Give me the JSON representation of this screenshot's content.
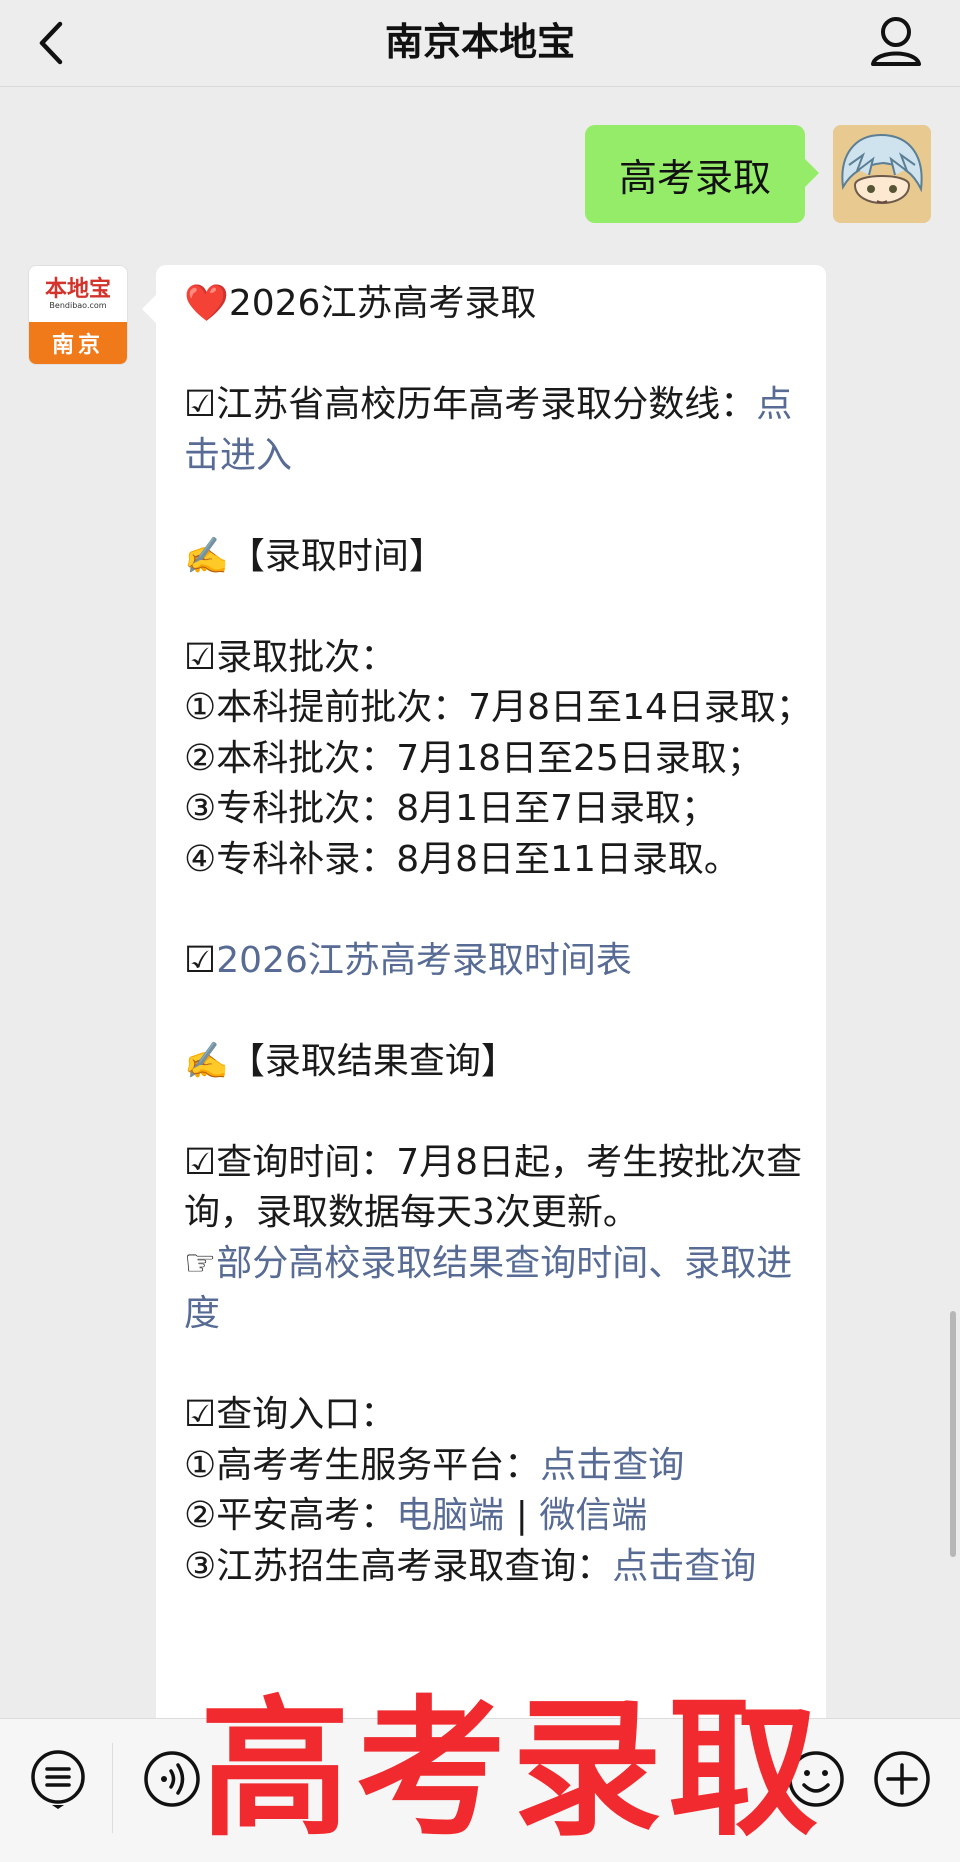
{
  "header": {
    "title": "南京本地宝"
  },
  "user_message": {
    "text": "高考录取"
  },
  "bot_avatar": {
    "logo": "本地宝",
    "site": "Bendibao.com",
    "city": "南京"
  },
  "bot_message": {
    "lines": [
      {
        "parts": [
          {
            "t": "❤️2026江苏高考录取"
          }
        ]
      },
      {
        "blank": true
      },
      {
        "parts": [
          {
            "t": "☑江苏省高校历年高考录取分数线："
          },
          {
            "t": "点击进入",
            "link": true
          }
        ]
      },
      {
        "blank": true
      },
      {
        "parts": [
          {
            "t": "✍️【录取时间】"
          }
        ]
      },
      {
        "blank": true
      },
      {
        "parts": [
          {
            "t": "☑录取批次："
          }
        ]
      },
      {
        "parts": [
          {
            "t": "①本科提前批次：7月8日至14日录取；"
          }
        ]
      },
      {
        "parts": [
          {
            "t": "②本科批次：7月18日至25日录取；"
          }
        ]
      },
      {
        "parts": [
          {
            "t": "③专科批次：8月1日至7日录取；"
          }
        ]
      },
      {
        "parts": [
          {
            "t": "④专科补录：8月8日至11日录取。"
          }
        ]
      },
      {
        "blank": true
      },
      {
        "parts": [
          {
            "t": "☑"
          },
          {
            "t": "2026江苏高考录取时间表",
            "link": true
          }
        ]
      },
      {
        "blank": true
      },
      {
        "parts": [
          {
            "t": "✍️【录取结果查询】"
          }
        ]
      },
      {
        "blank": true
      },
      {
        "parts": [
          {
            "t": "☑查询时间：7月8日起，考生按批次查询，录取数据每天3次更新。"
          }
        ]
      },
      {
        "parts": [
          {
            "t": "☞"
          },
          {
            "t": "部分高校录取结果查询时间、录取进度",
            "link": true
          }
        ]
      },
      {
        "blank": true
      },
      {
        "parts": [
          {
            "t": "☑查询入口："
          }
        ]
      },
      {
        "parts": [
          {
            "t": "①高考考生服务平台："
          },
          {
            "t": "点击查询",
            "link": true
          }
        ]
      },
      {
        "parts": [
          {
            "t": "②平安高考："
          },
          {
            "t": "电脑端",
            "link": true
          },
          {
            "t": " | "
          },
          {
            "t": "微信端",
            "link": true
          }
        ]
      },
      {
        "parts": [
          {
            "t": "③江苏招生高考录取查询："
          },
          {
            "t": "点击查询",
            "link": true
          }
        ]
      }
    ]
  },
  "overlay_text": "高考录取",
  "icons": {
    "back": "chevron-left-icon",
    "profile": "person-icon",
    "menu": "menu-list-icon",
    "voice": "voice-icon",
    "emoji": "emoji-icon",
    "add": "plus-icon"
  }
}
